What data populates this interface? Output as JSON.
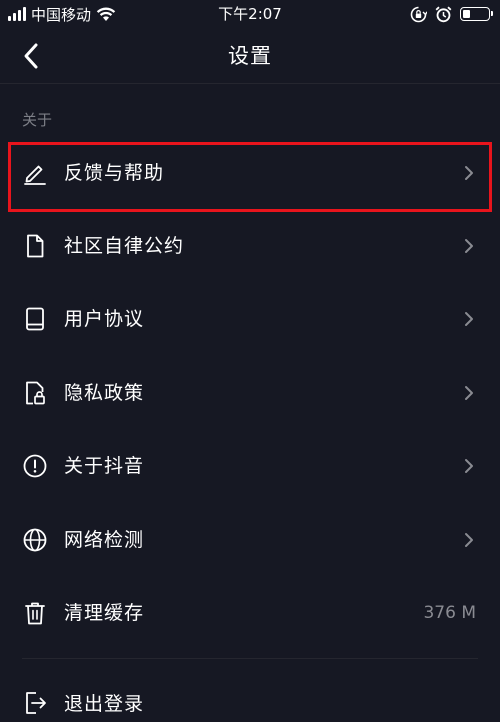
{
  "status_bar": {
    "carrier": "中国移动",
    "time": "下午2:07",
    "battery_level": 0.3
  },
  "nav": {
    "title": "设置",
    "back_icon": "chevron-left-icon"
  },
  "section": {
    "header": "关于"
  },
  "menu": {
    "items": [
      {
        "label": "反馈与帮助",
        "icon": "pencil-icon",
        "value": ""
      },
      {
        "label": "社区自律公约",
        "icon": "document-icon",
        "value": ""
      },
      {
        "label": "用户协议",
        "icon": "book-icon",
        "value": ""
      },
      {
        "label": "隐私政策",
        "icon": "lock-document-icon",
        "value": ""
      },
      {
        "label": "关于抖音",
        "icon": "info-circle-icon",
        "value": ""
      },
      {
        "label": "网络检测",
        "icon": "globe-icon",
        "value": ""
      },
      {
        "label": "清理缓存",
        "icon": "trash-icon",
        "value": "376 M"
      }
    ],
    "logout_label": "退出登录"
  },
  "colors": {
    "background": "#161823",
    "highlight": "#e8141c",
    "secondary_text": "#7d7f87"
  }
}
